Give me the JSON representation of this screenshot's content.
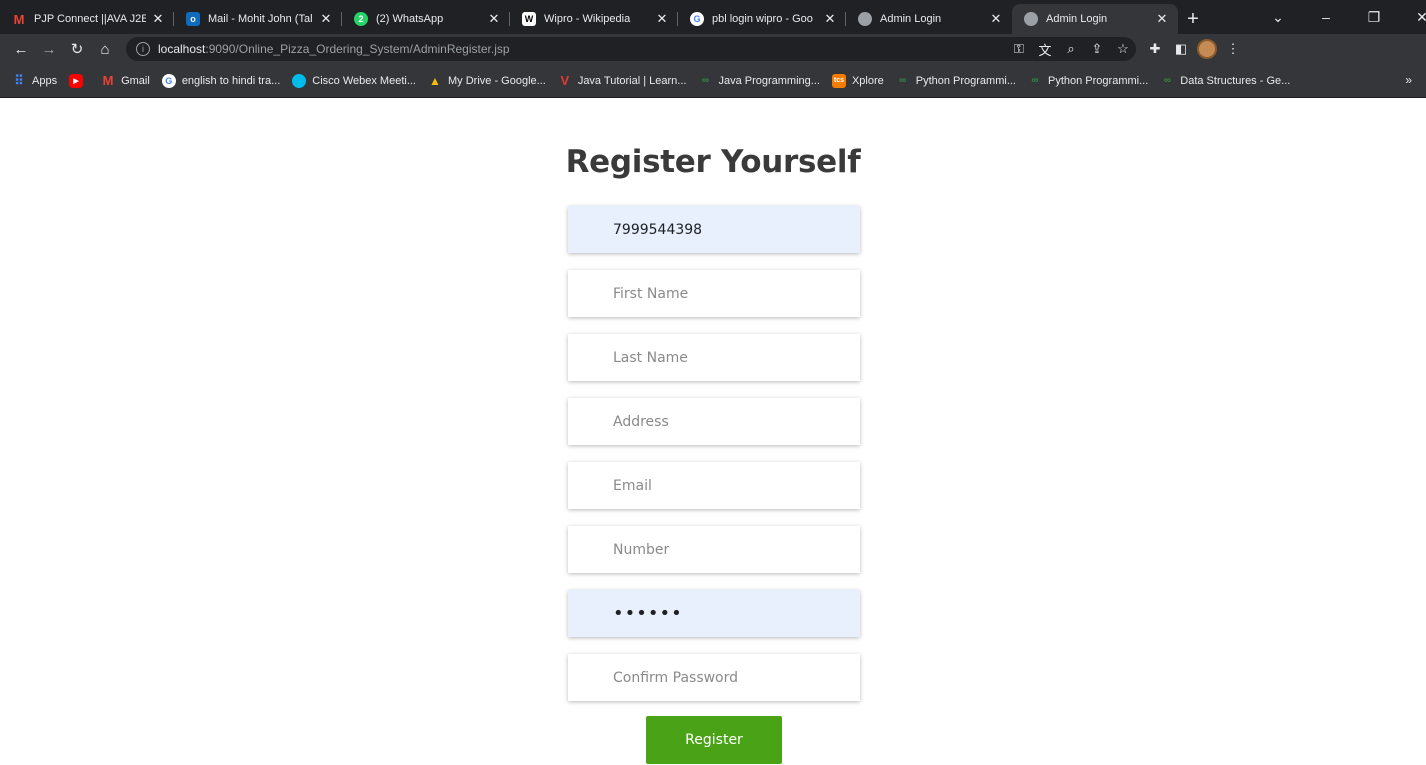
{
  "browser": {
    "tabs": [
      {
        "title": "PJP Connect ||AVA J2E",
        "favicon": "gmail-icon",
        "color": "#ea4335",
        "glyph": "M"
      },
      {
        "title": "Mail - Mohit John (Tal",
        "favicon": "outlook-icon",
        "color": "#0f6cbd",
        "glyph": "o"
      },
      {
        "title": "(2) WhatsApp",
        "favicon": "whatsapp-icon",
        "color": "#25d366",
        "glyph": "2"
      },
      {
        "title": "Wipro - Wikipedia",
        "favicon": "wikipedia-icon",
        "color": "#ffffff",
        "glyph": "W"
      },
      {
        "title": "pbl login wipro - Goo",
        "favicon": "google-icon",
        "color": "#ffffff",
        "glyph": "G"
      },
      {
        "title": "Admin Login",
        "favicon": "globe-icon",
        "color": "#9aa0a6",
        "glyph": ""
      },
      {
        "title": "Admin Login",
        "favicon": "globe-icon",
        "color": "#9aa0a6",
        "glyph": "",
        "active": true
      }
    ],
    "url_host": "localhost",
    "url_path": ":9090/Online_Pizza_Ordering_System/AdminRegister.jsp",
    "bookmarks": [
      {
        "label": "Apps",
        "icon": "apps-grid-icon",
        "color": "#4285f4"
      },
      {
        "label": "",
        "icon": "youtube-icon",
        "color": "#ff0000"
      },
      {
        "label": "Gmail",
        "icon": "gmail-icon",
        "color": "#ea4335"
      },
      {
        "label": "english to hindi tra...",
        "icon": "google-icon",
        "color": "#ffffff"
      },
      {
        "label": "Cisco Webex Meeti...",
        "icon": "webex-icon",
        "color": "#00bceb"
      },
      {
        "label": "My Drive - Google...",
        "icon": "google-drive-icon",
        "color": "#fbbc04"
      },
      {
        "label": "Java Tutorial | Learn...",
        "icon": "vtutor-icon",
        "color": "#e53935"
      },
      {
        "label": "Java Programming...",
        "icon": "gfg-icon",
        "color": "#2f8d46"
      },
      {
        "label": "Xplore",
        "icon": "tcs-icon",
        "color": "#f57c00"
      },
      {
        "label": "Python Programmi...",
        "icon": "gfg-icon",
        "color": "#2f8d46"
      },
      {
        "label": "Python Programmi...",
        "icon": "gfg-icon",
        "color": "#2f8d46"
      },
      {
        "label": "Data Structures - Ge...",
        "icon": "gfg-icon",
        "color": "#2f8d46"
      }
    ],
    "bookmarks_more": "»"
  },
  "page": {
    "title": "Register Yourself",
    "fields": {
      "username_value": "7999544398",
      "first_name_placeholder": "First Name",
      "last_name_placeholder": "Last Name",
      "address_placeholder": "Address",
      "email_placeholder": "Email",
      "number_placeholder": "Number",
      "password_value": "••••••",
      "confirm_password_placeholder": "Confirm Password"
    },
    "register_label": "Register",
    "colors": {
      "accent": "#4aa316",
      "autofill": "#e8f0fe"
    }
  }
}
